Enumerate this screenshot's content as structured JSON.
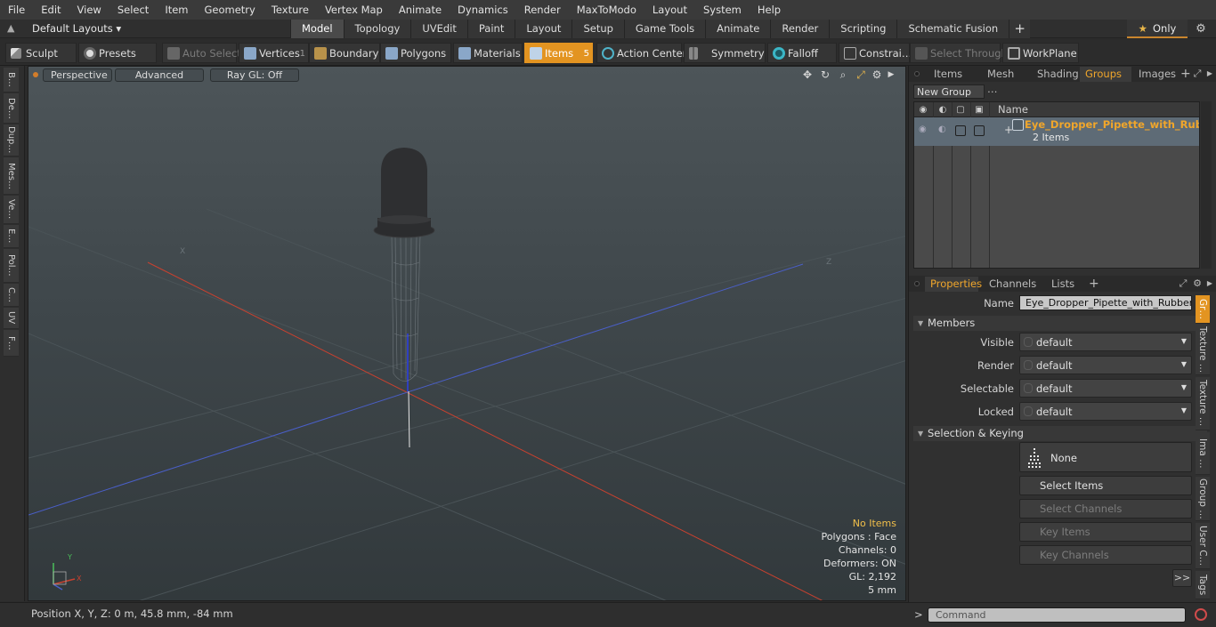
{
  "menu": [
    "File",
    "Edit",
    "View",
    "Select",
    "Item",
    "Geometry",
    "Texture",
    "Vertex Map",
    "Animate",
    "Dynamics",
    "Render",
    "MaxToModo",
    "Layout",
    "System",
    "Help"
  ],
  "layout": {
    "selector": "Default Layouts ▾",
    "tabs": [
      "Model",
      "Topology",
      "UVEdit",
      "Paint",
      "Layout",
      "Setup",
      "Game Tools",
      "Animate",
      "Render",
      "Scripting",
      "Schematic Fusion"
    ],
    "active_tab": "Model",
    "plus": "+",
    "only": "Only"
  },
  "toolbar": {
    "sculpt": "Sculpt",
    "presets": "Presets",
    "auto_select": "Auto Select",
    "vertices": "Vertices",
    "vertices_count": "1",
    "boundary": "Boundary",
    "polygons": "Polygons",
    "materials": "Materials",
    "items": "Items",
    "items_count": "5",
    "action_center": "Action Center",
    "symmetry": "Symmetry",
    "falloff": "Falloff",
    "constraints": "Constrai…",
    "select_through": "Select Through",
    "workplane": "WorkPlane"
  },
  "left_tools": [
    "B…",
    "De…",
    "Dup…",
    "Mes…",
    "Ve…",
    "E…",
    "Pol…",
    "C…",
    "UV",
    "F…"
  ],
  "viewport": {
    "view": "Perspective",
    "shading": "Advanced",
    "raygl": "Ray GL: Off",
    "stats": {
      "items": "No Items",
      "polygons": "Polygons : Face",
      "channels": "Channels: 0",
      "deformers": "Deformers: ON",
      "gl": "GL: 2,192",
      "unit": "5 mm"
    },
    "axis_x": "X",
    "axis_y": "Y",
    "axis_z": "Z",
    "colors": {
      "x_axis": "#c8412f",
      "z_axis": "#4a5fc8",
      "y_axis": "#2f3fc0"
    }
  },
  "status": {
    "position": "Position X, Y, Z:   0 m, 45.8 mm, -84 mm"
  },
  "top_panel": {
    "tabs": [
      "Items",
      "Mesh …",
      "Shading",
      "Groups",
      "Images"
    ],
    "active_tab": "Groups",
    "new_group": "New Group",
    "col_name": "Name",
    "group_name": "Eye_Dropper_Pipette_with_Rub…",
    "group_items": "2 Items"
  },
  "properties": {
    "tabs": [
      "Properties",
      "Channels",
      "Lists"
    ],
    "active_tab": "Properties",
    "name_label": "Name",
    "name_value": "Eye_Dropper_Pipette_with_Rubber_H",
    "members": "Members",
    "visible_label": "Visible",
    "visible_value": "default",
    "render_label": "Render",
    "render_value": "default",
    "selectable_label": "Selectable",
    "selectable_value": "default",
    "locked_label": "Locked",
    "locked_value": "default",
    "selection_keying": "Selection & Keying",
    "none": "None",
    "select_items": "Select Items",
    "select_channels": "Select Channels",
    "key_items": "Key Items",
    "key_channels": "Key Channels",
    "more": ">>"
  },
  "right_vtabs": [
    "Gr…",
    "Texture …",
    "Texture …",
    "Ima …",
    "Group …",
    "User C…",
    "Tags"
  ],
  "command": {
    "placeholder": "Command"
  }
}
